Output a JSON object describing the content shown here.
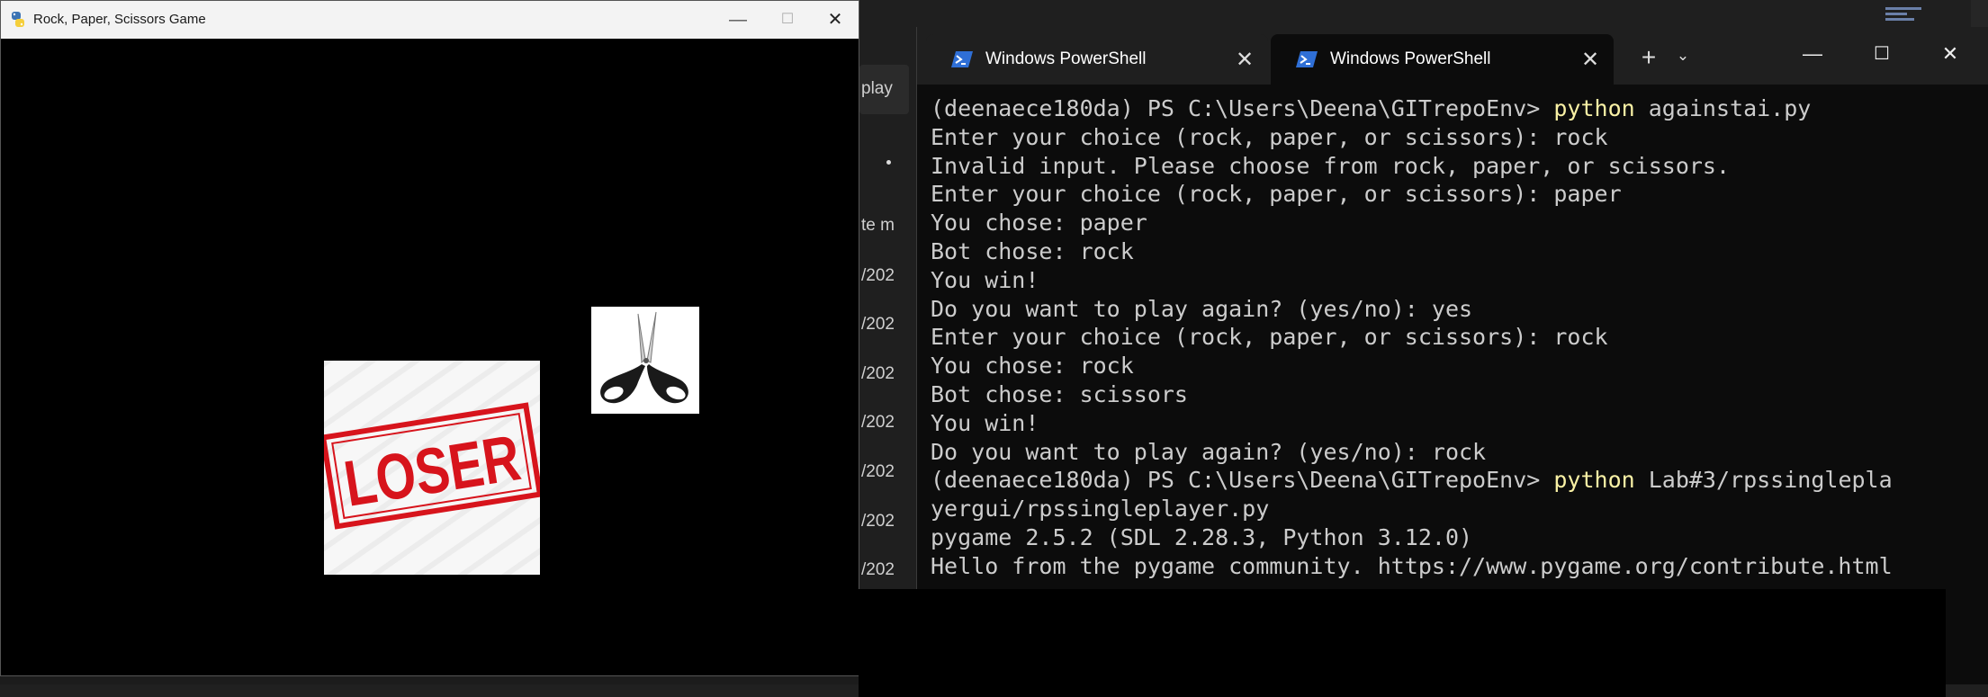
{
  "pygame_window": {
    "title": "Rock, Paper, Scissors Game",
    "minimize_glyph": "—",
    "maximize_glyph": "☐",
    "close_glyph": "✕",
    "loser_text": "LOSER",
    "icons": {
      "app": "python-icon",
      "loser": "loser-stamp-image",
      "scissors": "scissors-image"
    }
  },
  "background_app": {
    "fragments": [
      "play",
      "te m",
      "/202",
      "/202",
      "/202",
      "/202",
      "/202",
      "/202",
      "/202"
    ]
  },
  "terminal": {
    "tabs": [
      {
        "label": "Windows PowerShell",
        "active": false,
        "icon": "powershell-icon"
      },
      {
        "label": "Windows PowerShell",
        "active": true,
        "icon": "powershell-icon"
      }
    ],
    "new_tab_glyph": "+",
    "dropdown_glyph": "⌄",
    "minimize_glyph": "—",
    "maximize_glyph": "☐",
    "close_glyph": "✕",
    "lines": [
      {
        "prompt": "(deenaece180da) PS C:\\Users\\Deena\\GITrepoEnv> ",
        "cmd": "python",
        "arg": " againstai.py"
      },
      {
        "text": "Enter your choice (rock, paper, or scissors): rock"
      },
      {
        "text": "Invalid input. Please choose from rock, paper, or scissors."
      },
      {
        "text": "Enter your choice (rock, paper, or scissors): paper"
      },
      {
        "text": "You chose: paper"
      },
      {
        "text": "Bot chose: rock"
      },
      {
        "text": "You win!"
      },
      {
        "text": "Do you want to play again? (yes/no): yes"
      },
      {
        "text": "Enter your choice (rock, paper, or scissors): rock"
      },
      {
        "text": "You chose: rock"
      },
      {
        "text": "Bot chose: scissors"
      },
      {
        "text": "You win!"
      },
      {
        "text": "Do you want to play again? (yes/no): rock"
      },
      {
        "prompt": "(deenaece180da) PS C:\\Users\\Deena\\GITrepoEnv> ",
        "cmd": "python",
        "arg": " Lab#3/rpssinglepla"
      },
      {
        "text": "yergui/rpssingleplayer.py"
      },
      {
        "text": "pygame 2.5.2 (SDL 2.28.3, Python 3.12.0)"
      },
      {
        "text": "Hello from the pygame community. https://www.pygame.org/contribute.html"
      }
    ]
  }
}
